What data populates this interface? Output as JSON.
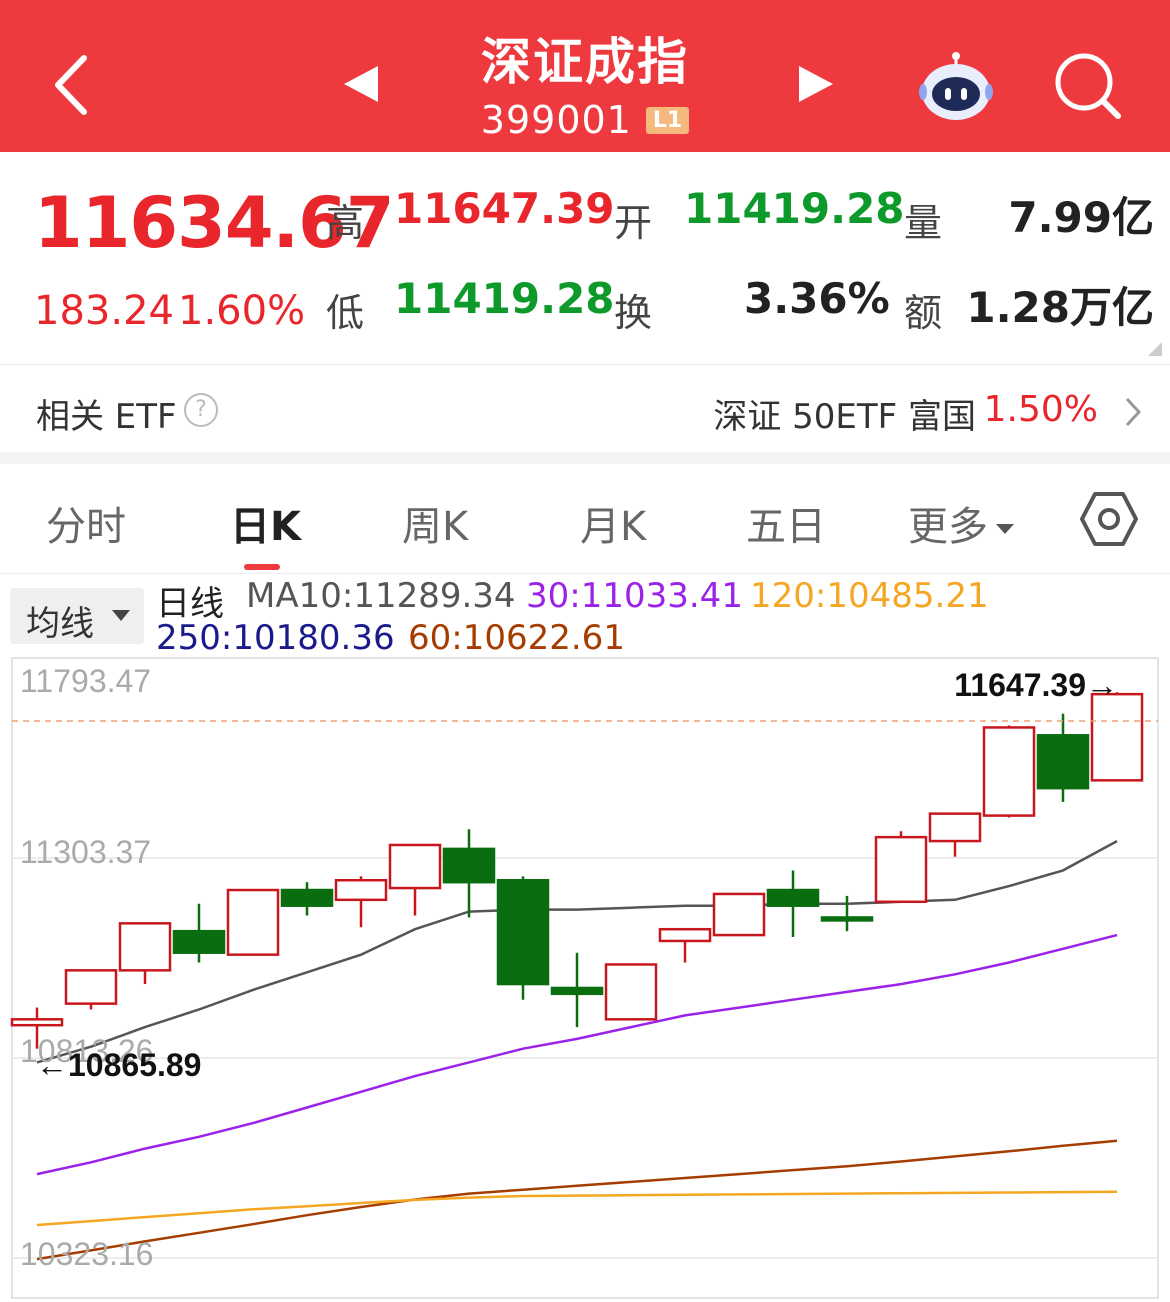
{
  "header": {
    "title": "深证成指",
    "code": "399001",
    "level_badge": "L1",
    "icons": [
      "back-arrow",
      "prev-triangle",
      "next-triangle",
      "robot-assistant",
      "search"
    ]
  },
  "quote": {
    "price": "11634.67",
    "change": "183.24",
    "change_pct": "1.60%",
    "high_label": "高",
    "high": "11647.39",
    "low_label": "低",
    "low": "11419.28",
    "open_label": "开",
    "open": "11419.28",
    "turnover_label": "换",
    "turnover": "3.36%",
    "volume_label": "量",
    "volume": "7.99亿",
    "amount_label": "额",
    "amount": "1.28万亿"
  },
  "etf": {
    "label": "相关 ETF",
    "help": "?",
    "name": "深证 50ETF 富国",
    "pct": "1.50%"
  },
  "tabs": {
    "items": [
      "分时",
      "日K",
      "周K",
      "月K",
      "五日",
      "更多"
    ],
    "active": "日K"
  },
  "legend": {
    "select_label": "均线",
    "line_type": "日线",
    "ma10": "MA10:11289.34",
    "ma30": "30:11033.41",
    "ma120": "120:10485.21",
    "ma250": "250:10180.36",
    "ma60": "60:10622.61"
  },
  "colors": {
    "header_bg": "#ee3a3e",
    "up": "#e8262b",
    "down": "#0e9a2a",
    "candle_up": "#c8161d",
    "candle_down": "#0a6e11",
    "ma10": "#555555",
    "ma30": "#9b22e8",
    "ma60": "#a63d00",
    "ma120": "#f5a623",
    "ma250": "#1a1a8c"
  },
  "chart_data": {
    "type": "candlestick",
    "y_ticks": [
      "11793.47",
      "11303.37",
      "10813.26",
      "10323.16"
    ],
    "ylim": [
      10323.16,
      11793.47
    ],
    "max_marker": "11647.39→",
    "min_marker": "←10865.89",
    "candles": [
      {
        "o": 10920,
        "c": 10935,
        "h": 10965,
        "l": 10860
      },
      {
        "o": 10975,
        "c": 11060,
        "h": 11060,
        "l": 10960
      },
      {
        "o": 11060,
        "c": 11180,
        "h": 11180,
        "l": 11025
      },
      {
        "o": 11160,
        "c": 11105,
        "h": 11230,
        "l": 11080
      },
      {
        "o": 11100,
        "c": 11265,
        "h": 11265,
        "l": 11100
      },
      {
        "o": 11265,
        "c": 11225,
        "h": 11285,
        "l": 11200
      },
      {
        "o": 11240,
        "c": 11290,
        "h": 11300,
        "l": 11170
      },
      {
        "o": 11270,
        "c": 11380,
        "h": 11380,
        "l": 11200
      },
      {
        "o": 11370,
        "c": 11285,
        "h": 11420,
        "l": 11195
      },
      {
        "o": 11290,
        "c": 11025,
        "h": 11300,
        "l": 10985
      },
      {
        "o": 11015,
        "c": 11000,
        "h": 11105,
        "l": 10915
      },
      {
        "o": 10935,
        "c": 11075,
        "h": 11075,
        "l": 10935
      },
      {
        "o": 11135,
        "c": 11165,
        "h": 11165,
        "l": 11080
      },
      {
        "o": 11150,
        "c": 11255,
        "h": 11255,
        "l": 11150
      },
      {
        "o": 11265,
        "c": 11225,
        "h": 11315,
        "l": 11145
      },
      {
        "o": 11195,
        "c": 11190,
        "h": 11250,
        "l": 11160
      },
      {
        "o": 11235,
        "c": 11400,
        "h": 11415,
        "l": 11235
      },
      {
        "o": 11390,
        "c": 11460,
        "h": 11460,
        "l": 11350
      },
      {
        "o": 11455,
        "c": 11680,
        "h": 11685,
        "l": 11450
      },
      {
        "o": 11660,
        "c": 11525,
        "h": 11715,
        "l": 11490
      },
      {
        "o": 11545,
        "c": 11765,
        "h": 11770,
        "l": 11545
      }
    ],
    "ma10": [
      10825,
      10865,
      10915,
      10960,
      11010,
      11055,
      11100,
      11165,
      11210,
      11215,
      11215,
      11220,
      11225,
      11225,
      11230,
      11230,
      11235,
      11240,
      11275,
      11315,
      11390
    ],
    "ma30": [
      10540,
      10570,
      10605,
      10635,
      10670,
      10710,
      10750,
      10790,
      10825,
      10860,
      10885,
      10915,
      10945,
      10965,
      10985,
      11005,
      11025,
      11050,
      11080,
      11115,
      11150
    ],
    "ma120": [
      10410,
      10420,
      10430,
      10440,
      10450,
      10458,
      10466,
      10474,
      10480,
      10484,
      10485,
      10486,
      10487,
      10488,
      10489,
      10490,
      10491,
      10492,
      10493,
      10494,
      10495
    ],
    "ma60": [
      10323,
      10345,
      10368,
      10390,
      10412,
      10435,
      10456,
      10475,
      10490,
      10500,
      10510,
      10520,
      10530,
      10540,
      10550,
      10560,
      10572,
      10585,
      10598,
      10612,
      10625
    ]
  }
}
